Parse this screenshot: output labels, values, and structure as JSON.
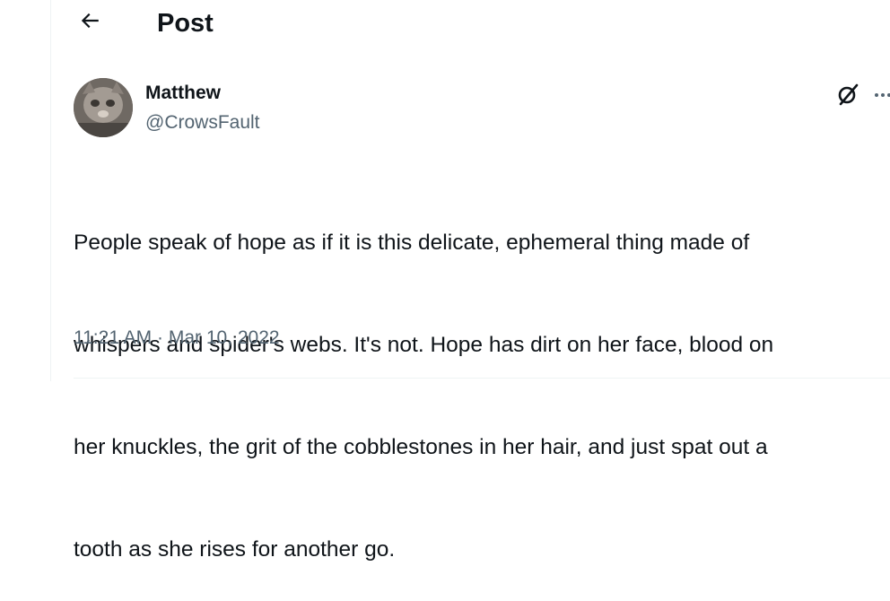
{
  "header": {
    "back_icon": "arrow-left-icon",
    "title": "Post"
  },
  "post": {
    "author": {
      "name": "Matthew",
      "handle": "@CrowsFault",
      "avatar": "cat-photo-avatar"
    },
    "actions": {
      "grok_icon": "grok-icon",
      "more_icon": "more-icon"
    },
    "text_lines": [
      "People speak of hope as if it is this delicate, ephemeral thing made of",
      "whispers and spider's webs. It's not. Hope has dirt on her face, blood on",
      "her knuckles, the grit of the cobblestones in her hair, and just spat out a",
      "tooth as she rises for another go."
    ],
    "timestamp": "11:21 AM · Mar 10, 2022"
  },
  "colors": {
    "text_primary": "#0f1419",
    "text_secondary": "#536471",
    "border": "#eff3f4"
  }
}
